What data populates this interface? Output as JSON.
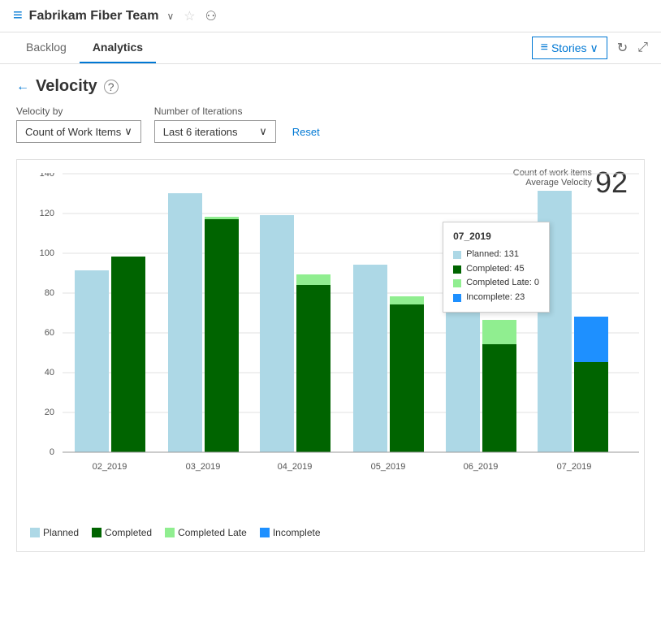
{
  "header": {
    "icon": "≡",
    "title": "Fabrikam Fiber Team",
    "chevron": "∨",
    "star": "☆",
    "people": "⚇"
  },
  "nav": {
    "tabs": [
      {
        "id": "backlog",
        "label": "Backlog",
        "active": false
      },
      {
        "id": "analytics",
        "label": "Analytics",
        "active": true
      }
    ],
    "right": {
      "stories_label": "Stories",
      "chevron": "∨"
    }
  },
  "page": {
    "back_icon": "←",
    "title": "Velocity",
    "help_icon": "?"
  },
  "filters": {
    "velocity_by_label": "Velocity by",
    "velocity_by_value": "Count of Work Items",
    "iterations_label": "Number of Iterations",
    "iterations_value": "Last 6 iterations",
    "reset_label": "Reset"
  },
  "chart": {
    "stat_label": "Count of work items",
    "avg_label": "Average Velocity",
    "avg_value": "92",
    "y_axis": [
      0,
      20,
      40,
      60,
      80,
      100,
      120,
      140
    ],
    "bars": [
      {
        "label": "02_2019",
        "planned": 91,
        "completed": 98,
        "completed_late": 0,
        "incomplete": 0
      },
      {
        "label": "03_2019",
        "planned": 130,
        "completed": 117,
        "completed_late": 0,
        "incomplete": 0
      },
      {
        "label": "04_2019",
        "planned": 119,
        "completed": 84,
        "completed_late": 5,
        "incomplete": 0
      },
      {
        "label": "05_2019",
        "planned": 94,
        "completed": 74,
        "completed_late": 4,
        "incomplete": 0
      },
      {
        "label": "06_2019",
        "planned": 91,
        "completed": 54,
        "completed_late": 12,
        "incomplete": 0
      },
      {
        "label": "07_2019",
        "planned": 131,
        "completed": 45,
        "completed_late": 0,
        "incomplete": 23
      }
    ],
    "tooltip": {
      "title": "07_2019",
      "rows": [
        {
          "color": "#add8e6",
          "label": "Planned: 131"
        },
        {
          "color": "#006400",
          "label": "Completed: 45"
        },
        {
          "color": "#90ee90",
          "label": "Completed Late: 0"
        },
        {
          "color": "#1e90ff",
          "label": "Incomplete: 23"
        }
      ]
    },
    "legend": [
      {
        "color": "#add8e6",
        "label": "Planned"
      },
      {
        "color": "#006400",
        "label": "Completed"
      },
      {
        "color": "#90ee90",
        "label": "Completed Late"
      },
      {
        "color": "#1e90ff",
        "label": "Incomplete"
      }
    ]
  }
}
